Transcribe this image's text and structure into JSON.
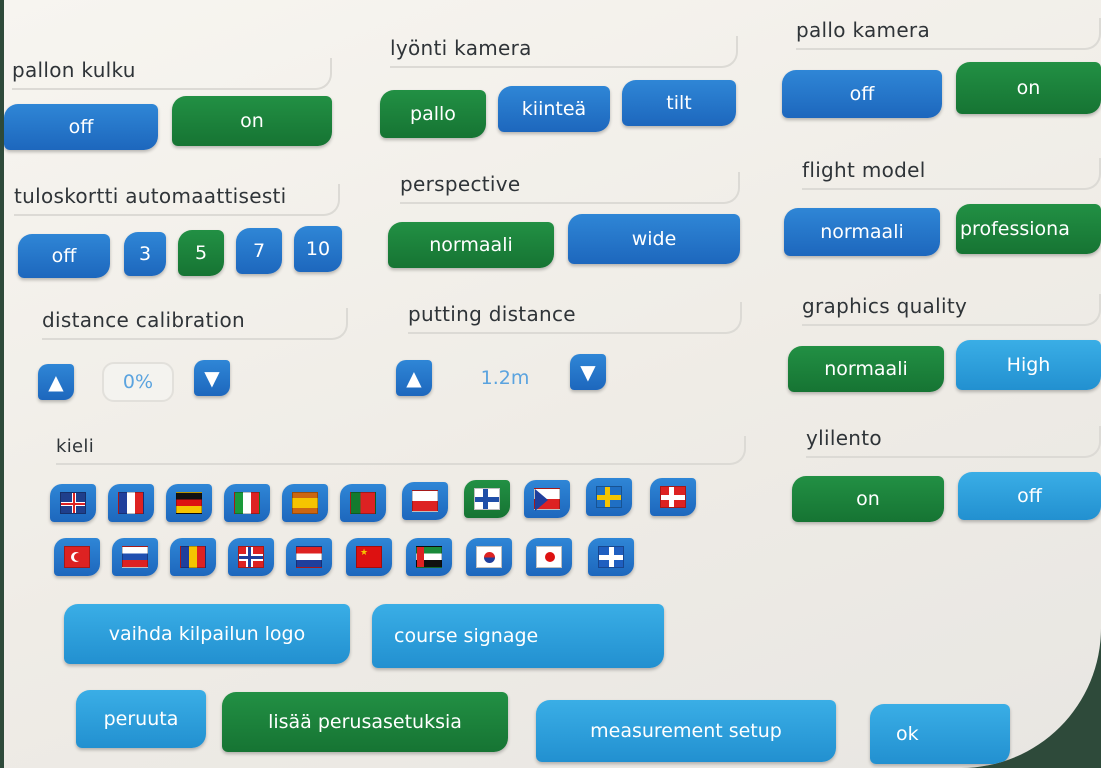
{
  "pallon_kulku": {
    "label": "pallon kulku",
    "off": "off",
    "on": "on"
  },
  "lyonti_kamera": {
    "label": "lyönti kamera",
    "pallo": "pallo",
    "kiintea": "kiinteä",
    "tilt": "tilt"
  },
  "pallo_kamera": {
    "label": "pallo kamera",
    "off": "off",
    "on": "on"
  },
  "tuloskortti": {
    "label": "tuloskortti automaattisesti",
    "off": "off",
    "opt3": "3",
    "opt5": "5",
    "opt7": "7",
    "opt10": "10"
  },
  "perspective": {
    "label": "perspective",
    "normaali": "normaali",
    "wide": "wide"
  },
  "flight_model": {
    "label": "flight model",
    "normaali": "normaali",
    "professional": "professiona"
  },
  "distance_calibration": {
    "label": "distance calibration",
    "value": "0%"
  },
  "putting_distance": {
    "label": "putting distance",
    "value": "1.2m"
  },
  "graphics_quality": {
    "label": "graphics quality",
    "normaali": "normaali",
    "high": "High"
  },
  "kieli": {
    "label": "kieli"
  },
  "ylilento": {
    "label": "ylilento",
    "on": "on",
    "off": "off"
  },
  "actions": {
    "vaihda_logo": "vaihda kilpailun logo",
    "course_signage": "course signage",
    "peruuta": "peruuta",
    "lisaa": "lisää perusasetuksia",
    "measurement": "measurement setup",
    "ok": "ok"
  },
  "colors": {
    "blue": "#1d67bd",
    "light_blue": "#2290d0",
    "green": "#167433",
    "selected": "green"
  }
}
